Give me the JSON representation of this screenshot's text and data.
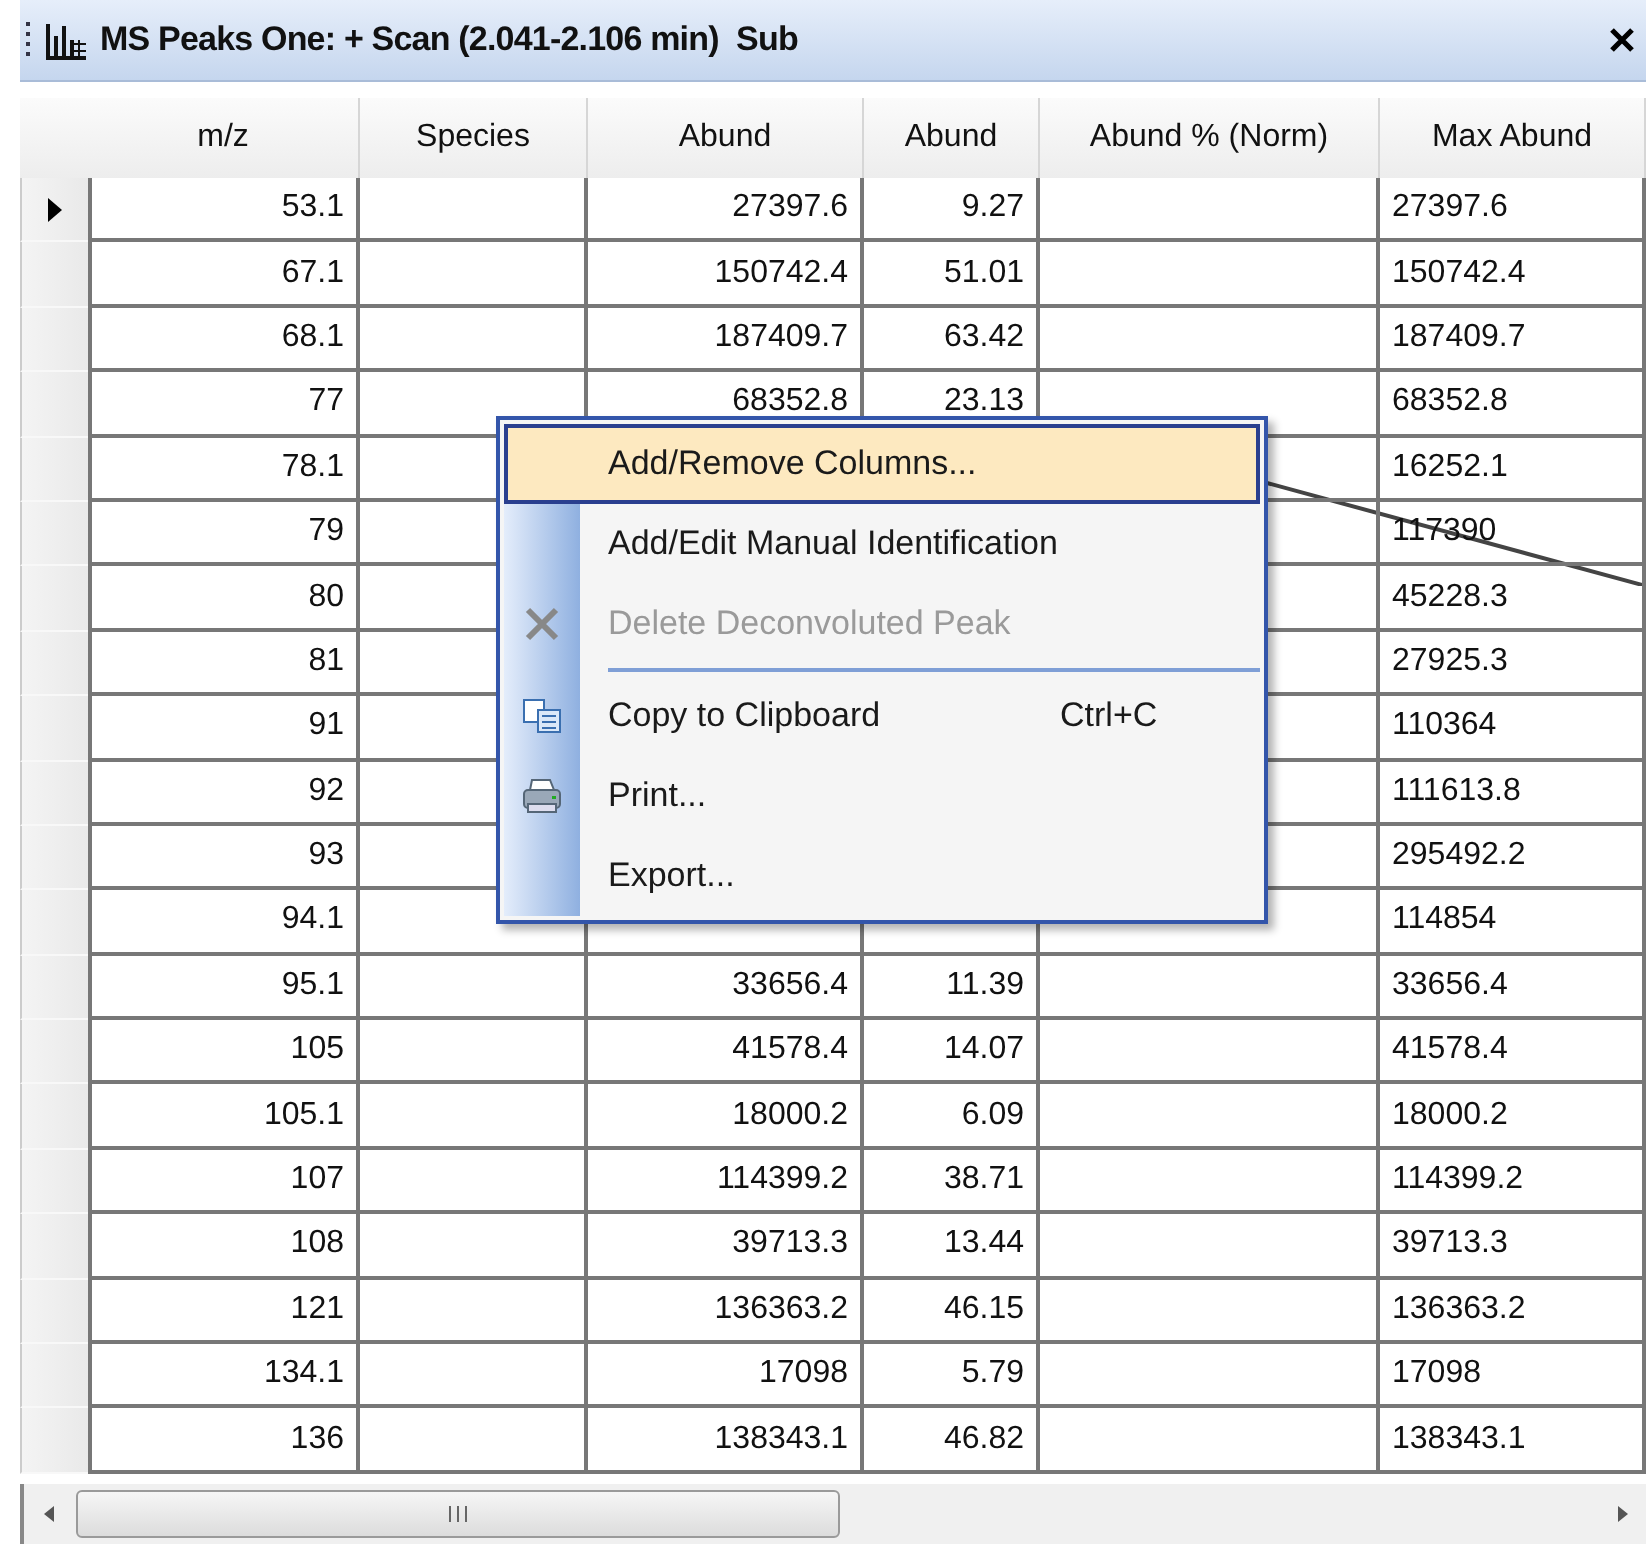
{
  "window": {
    "title": "MS Peaks One: + Scan (2.041-2.106 min)  Sub"
  },
  "table": {
    "columns": [
      "m/z",
      "Species",
      "Abund",
      "Abund",
      "Abund % (Norm)",
      "Max Abund"
    ],
    "rows": [
      {
        "selected": true,
        "cells": [
          "53.1",
          null,
          "27397.6",
          "9.27",
          null,
          "27397.6"
        ]
      },
      {
        "selected": false,
        "cells": [
          "67.1",
          null,
          "150742.4",
          "51.01",
          null,
          "150742.4"
        ]
      },
      {
        "selected": false,
        "cells": [
          "68.1",
          null,
          "187409.7",
          "63.42",
          null,
          "187409.7"
        ]
      },
      {
        "selected": false,
        "cells": [
          "77",
          null,
          "68352.8",
          "23.13",
          null,
          "68352.8"
        ]
      },
      {
        "selected": false,
        "cells": [
          "78.1",
          null,
          null,
          null,
          null,
          "16252.1"
        ]
      },
      {
        "selected": false,
        "cells": [
          "79",
          null,
          null,
          null,
          null,
          "117390"
        ]
      },
      {
        "selected": false,
        "cells": [
          "80",
          null,
          null,
          null,
          null,
          "45228.3"
        ]
      },
      {
        "selected": false,
        "cells": [
          "81",
          null,
          null,
          null,
          null,
          "27925.3"
        ]
      },
      {
        "selected": false,
        "cells": [
          "91",
          null,
          null,
          null,
          null,
          "110364"
        ]
      },
      {
        "selected": false,
        "cells": [
          "92",
          null,
          null,
          null,
          null,
          "111613.8"
        ]
      },
      {
        "selected": false,
        "cells": [
          "93",
          null,
          null,
          null,
          null,
          "295492.2"
        ]
      },
      {
        "selected": false,
        "cells": [
          "94.1",
          null,
          null,
          null,
          null,
          "114854"
        ]
      },
      {
        "selected": false,
        "cells": [
          "95.1",
          null,
          "33656.4",
          "11.39",
          null,
          "33656.4"
        ]
      },
      {
        "selected": false,
        "cells": [
          "105",
          null,
          "41578.4",
          "14.07",
          null,
          "41578.4"
        ]
      },
      {
        "selected": false,
        "cells": [
          "105.1",
          null,
          "18000.2",
          "6.09",
          null,
          "18000.2"
        ]
      },
      {
        "selected": false,
        "cells": [
          "107",
          null,
          "114399.2",
          "38.71",
          null,
          "114399.2"
        ]
      },
      {
        "selected": false,
        "cells": [
          "108",
          null,
          "39713.3",
          "13.44",
          null,
          "39713.3"
        ]
      },
      {
        "selected": false,
        "cells": [
          "121",
          null,
          "136363.2",
          "46.15",
          null,
          "136363.2"
        ]
      },
      {
        "selected": false,
        "cells": [
          "134.1",
          null,
          "17098",
          "5.79",
          null,
          "17098"
        ]
      },
      {
        "selected": false,
        "cells": [
          "136",
          null,
          "138343.1",
          "46.82",
          null,
          "138343.1"
        ]
      }
    ]
  },
  "context_menu": {
    "items": [
      {
        "kind": "item",
        "label": "Add/Remove Columns...",
        "selected": true,
        "disabled": false
      },
      {
        "kind": "item",
        "label": "Add/Edit Manual Identification",
        "selected": false,
        "disabled": false
      },
      {
        "kind": "item",
        "label": "Delete Deconvoluted Peak",
        "selected": false,
        "disabled": true
      },
      {
        "kind": "separator"
      },
      {
        "kind": "item",
        "label": "Copy to Clipboard",
        "shortcut": "Ctrl+C",
        "selected": false,
        "disabled": false
      },
      {
        "kind": "item",
        "label": "Print...",
        "selected": false,
        "disabled": false
      },
      {
        "kind": "item",
        "label": "Export...",
        "selected": false,
        "disabled": false
      }
    ]
  }
}
